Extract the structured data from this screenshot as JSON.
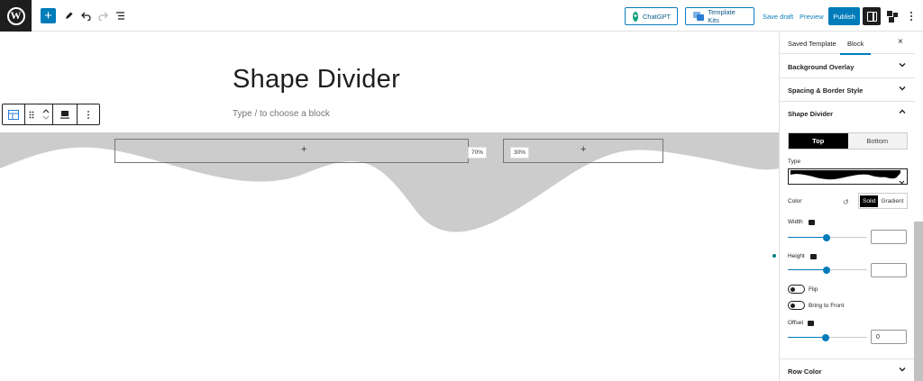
{
  "topbar": {
    "logo_letter": "W",
    "add_label": "+",
    "chatgpt_label": "ChatGPT",
    "template_kits_label": "Template Kits",
    "save_draft_label": "Save draft",
    "preview_label": "Preview",
    "publish_label": "Publish"
  },
  "canvas": {
    "title": "Shape Divider",
    "placeholder": "Type / to choose a block",
    "columns": [
      {
        "plus": "+",
        "width_label": "70%"
      },
      {
        "plus": "+",
        "width_label": "30%"
      }
    ],
    "divider_color": "#cccccc"
  },
  "sidebar": {
    "tabs": [
      "Saved Template",
      "Block"
    ],
    "active_tab": "Block",
    "close_label": "×",
    "panels": {
      "background_overlay": "Background Overlay",
      "spacing_border": "Spacing & Border Style",
      "shape_divider": "Shape Divider",
      "row_color": "Row Color"
    },
    "shape_divider": {
      "position_options": [
        "Top",
        "Bottom"
      ],
      "position_selected": "Top",
      "type_label": "Type",
      "color_label": "Color",
      "color_modes": [
        "Solid",
        "Gradient"
      ],
      "color_mode_selected": "Solid",
      "width_label": "Width",
      "width_value": "",
      "height_label": "Height",
      "height_value": "",
      "flip_label": "Flip",
      "bring_front_label": "Bring to Front",
      "offset_label": "Offset",
      "offset_value": "0"
    }
  },
  "colors": {
    "accent": "#007cba",
    "dark": "#1e1e1e",
    "divider_gray": "#cccccc"
  }
}
